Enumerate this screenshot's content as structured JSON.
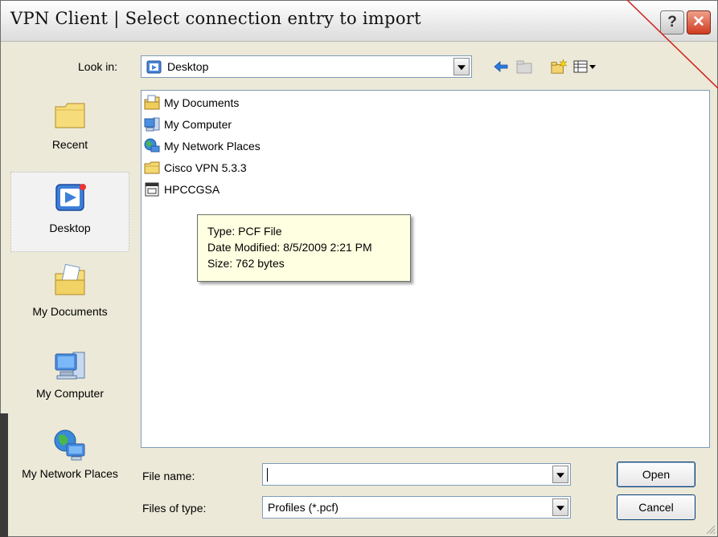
{
  "window": {
    "title": "VPN Client  |  Select connection entry to import",
    "help_glyph": "?",
    "close_glyph": "✕"
  },
  "toolbar": {
    "look_in_label": "Look in:",
    "look_in_value": "Desktop",
    "icons": [
      "back-icon",
      "up-folder-icon",
      "new-folder-icon",
      "view-menu-icon"
    ]
  },
  "places": [
    {
      "label": "Recent",
      "icon": "recent-folder-icon",
      "selected": false
    },
    {
      "label": "Desktop",
      "icon": "desktop-icon",
      "selected": true
    },
    {
      "label": "My Documents",
      "icon": "my-documents-icon",
      "selected": false
    },
    {
      "label": "My Computer",
      "icon": "my-computer-icon",
      "selected": false
    },
    {
      "label": "My Network Places",
      "icon": "network-places-icon",
      "selected": false
    }
  ],
  "files": [
    {
      "name": "My Documents",
      "icon": "documents-folder-icon"
    },
    {
      "name": "My Computer",
      "icon": "computer-icon"
    },
    {
      "name": "My Network Places",
      "icon": "network-icon"
    },
    {
      "name": "Cisco VPN 5.3.3",
      "icon": "folder-icon"
    },
    {
      "name": "HPCCGSA",
      "icon": "pcf-file-icon"
    }
  ],
  "tooltip": {
    "type": "Type: PCF File",
    "modified": "Date Modified: 8/5/2009 2:21 PM",
    "size": "Size: 762 bytes"
  },
  "form": {
    "file_name_label": "File name:",
    "file_name_value": "",
    "files_of_type_label": "Files of type:",
    "files_of_type_value": "Profiles (*.pcf)"
  },
  "buttons": {
    "open": "Open",
    "cancel": "Cancel"
  },
  "colors": {
    "dialog_bg": "#ece9d8",
    "tooltip_bg": "#ffffe1",
    "annotation_line": "#d0201a",
    "close_button": "#cf3a1f"
  }
}
